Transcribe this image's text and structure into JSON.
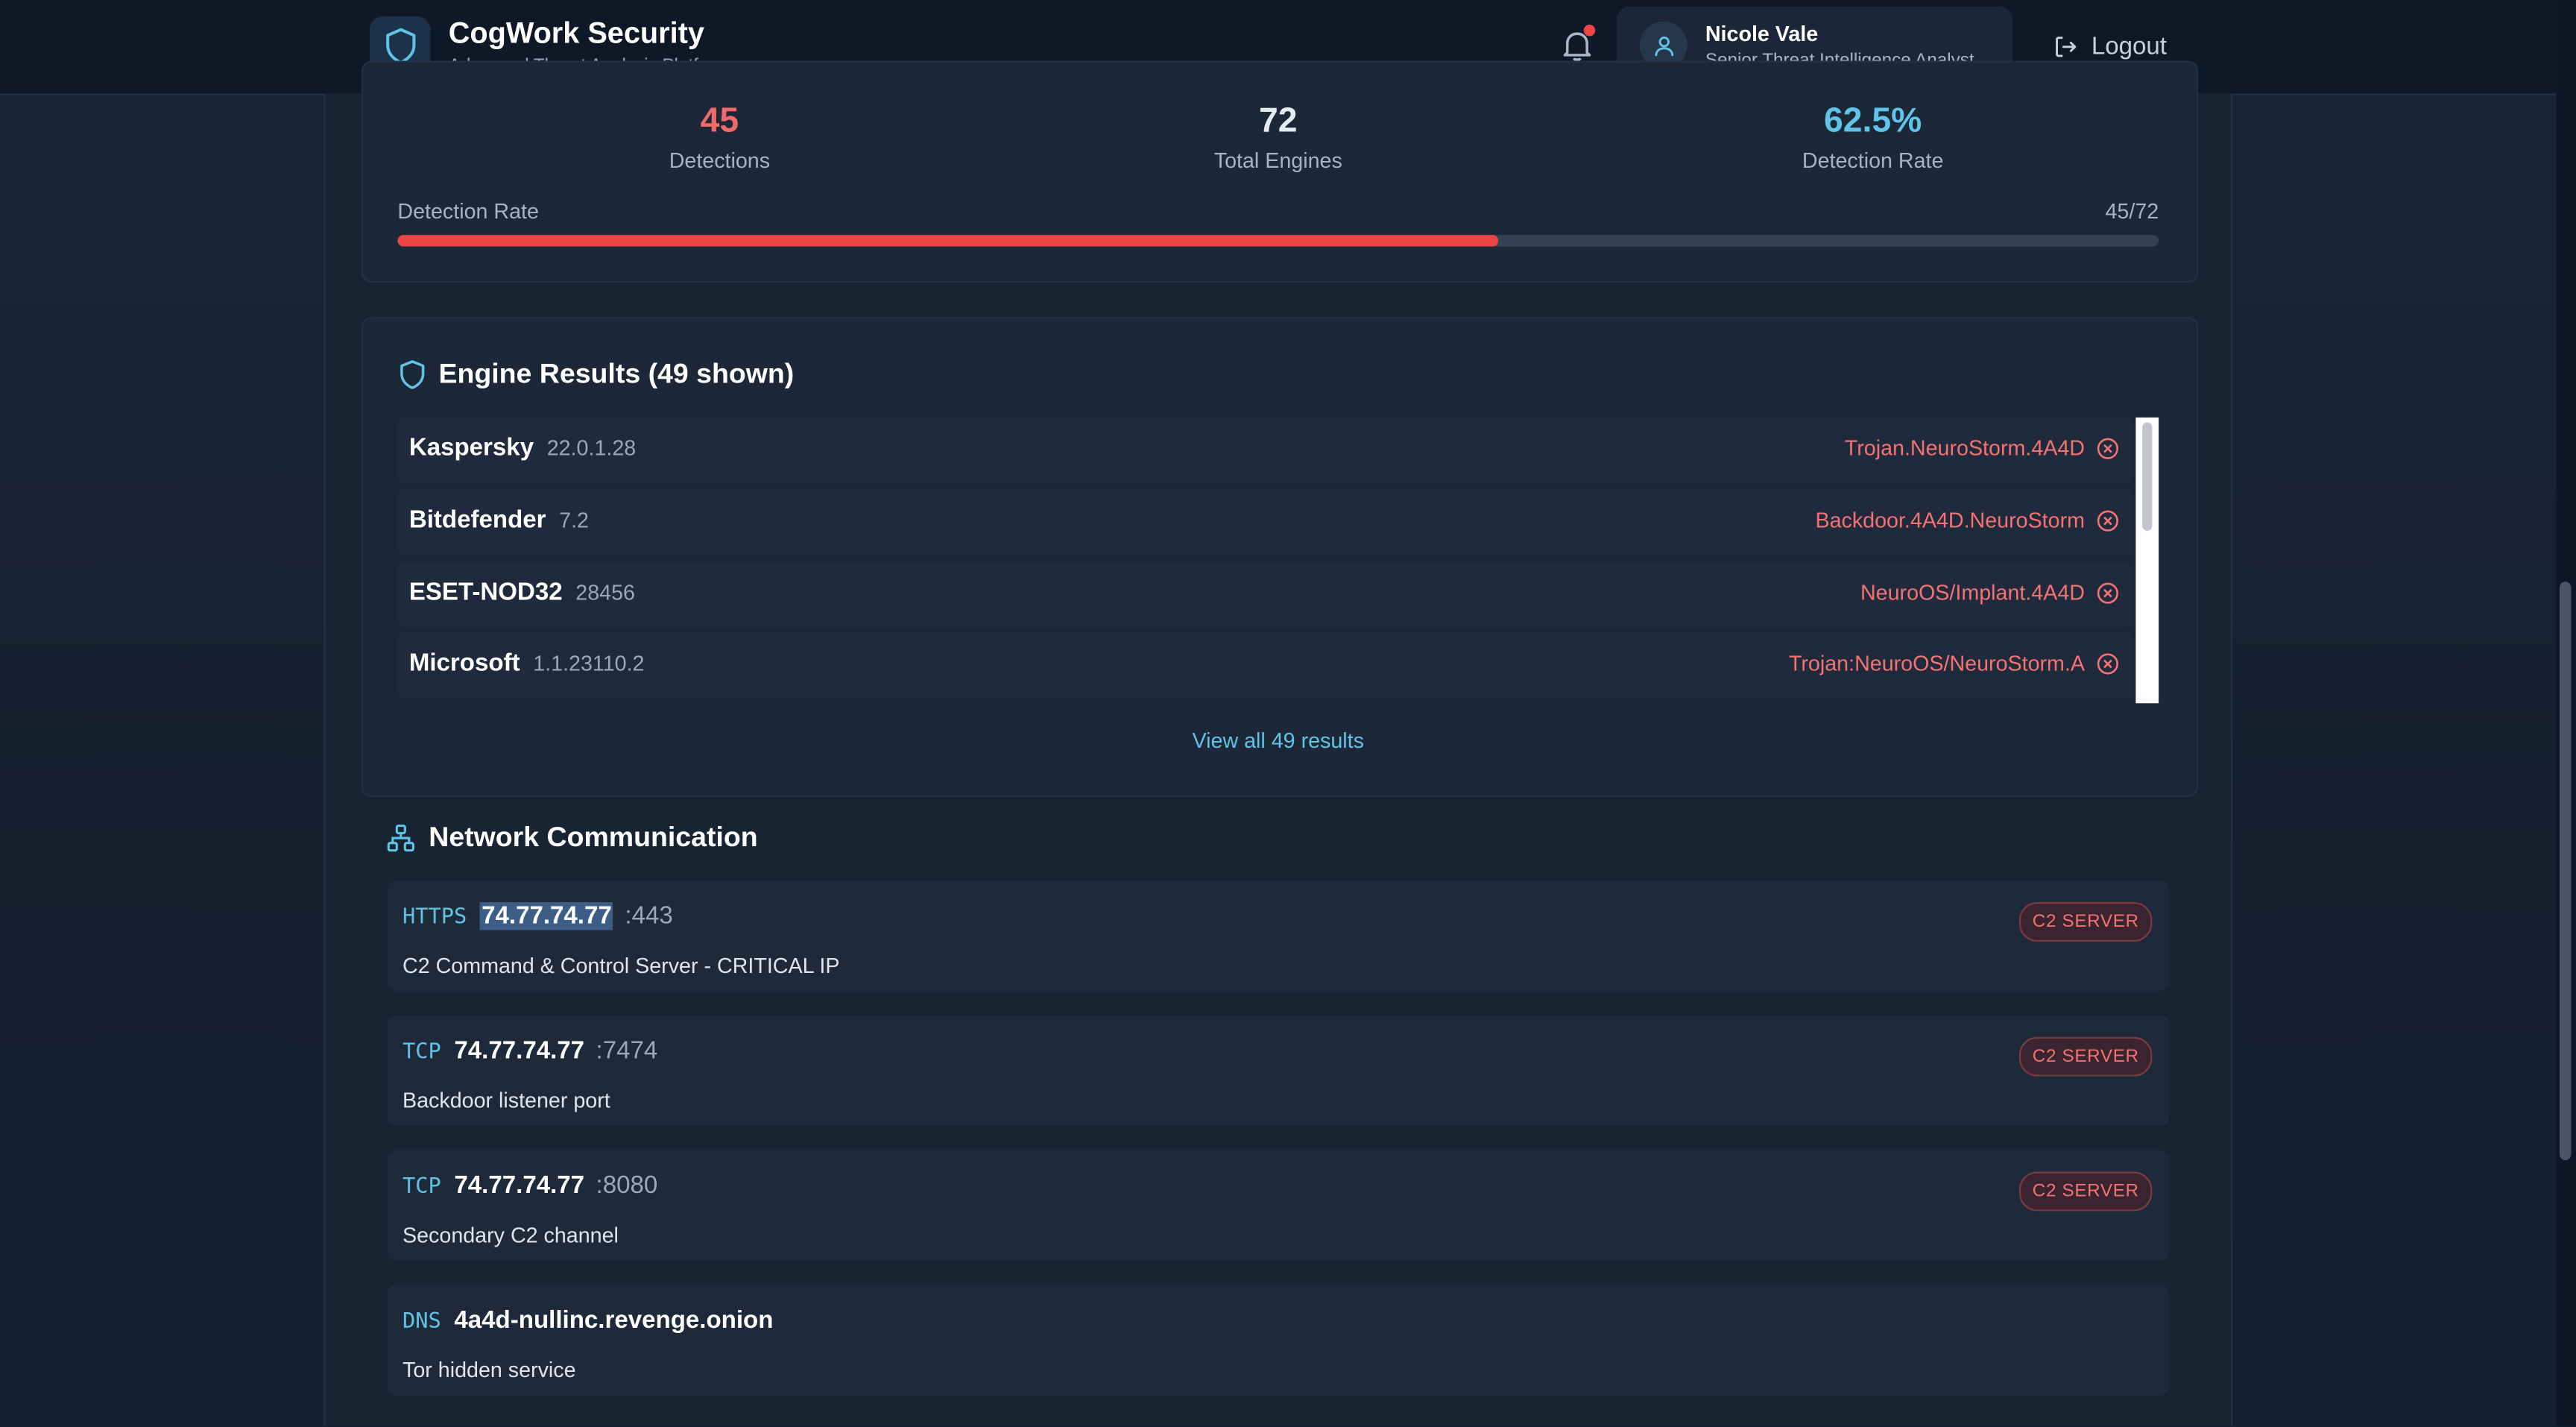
{
  "header": {
    "brand_title": "CogWork Security",
    "brand_subtitle": "Advanced Threat Analysis Platform",
    "user_name": "Nicole Vale",
    "user_role": "Senior Threat Intelligence Analyst",
    "logout_label": "Logout",
    "has_notification": true
  },
  "stats": {
    "detections_value": "45",
    "detections_label": "Detections",
    "engines_value": "72",
    "engines_label": "Total Engines",
    "rate_value": "62.5%",
    "rate_label": "Detection Rate",
    "bar_label": "Detection Rate",
    "bar_count": "45/72",
    "detection_fraction": 0.625
  },
  "engines": {
    "title": "Engine Results (49 shown)",
    "view_all": "View all 49 results",
    "rows": [
      {
        "name": "Kaspersky",
        "version": "22.0.1.28",
        "result": "Trojan.NeuroStorm.4A4D"
      },
      {
        "name": "Bitdefender",
        "version": "7.2",
        "result": "Backdoor.4A4D.NeuroStorm"
      },
      {
        "name": "ESET-NOD32",
        "version": "28456",
        "result": "NeuroOS/Implant.4A4D"
      },
      {
        "name": "Microsoft",
        "version": "1.1.23110.2",
        "result": "Trojan:NeuroOS/NeuroStorm.A"
      }
    ]
  },
  "network": {
    "title": "Network Communication",
    "items": [
      {
        "protocol": "HTTPS",
        "host": "74.77.74.77",
        "port": ":443",
        "description": "C2 Command & Control Server - CRITICAL IP",
        "badge": "C2 SERVER"
      },
      {
        "protocol": "TCP",
        "host": "74.77.74.77",
        "port": ":7474",
        "description": "Backdoor listener port",
        "badge": "C2 SERVER"
      },
      {
        "protocol": "TCP",
        "host": "74.77.74.77",
        "port": ":8080",
        "description": "Secondary C2 channel",
        "badge": "C2 SERVER"
      },
      {
        "protocol": "DNS",
        "host": "4a4d-nullinc.revenge.onion",
        "port": "",
        "description": "Tor hidden service",
        "badge": ""
      }
    ]
  },
  "colors": {
    "accent": "#60c3e6",
    "danger": "#ef4444",
    "danger_text": "#f47272",
    "background": "#16202f"
  }
}
